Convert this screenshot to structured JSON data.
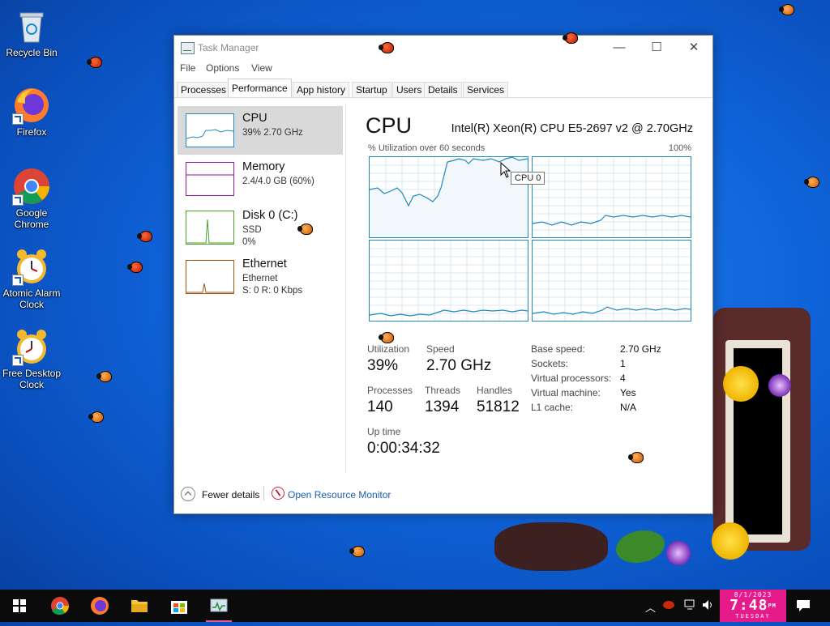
{
  "desktop": {
    "icons": [
      {
        "label": "Recycle Bin"
      },
      {
        "label": "Firefox"
      },
      {
        "label": "Google Chrome"
      },
      {
        "label": "Atomic Alarm Clock"
      },
      {
        "label": "Free Desktop Clock"
      }
    ]
  },
  "window": {
    "title": "Task Manager",
    "controls": {
      "minimize": "—",
      "maximize": "☐",
      "close": "✕"
    },
    "menu": [
      "File",
      "Options",
      "View"
    ],
    "tabs": [
      "Processes",
      "Performance",
      "App history",
      "Startup",
      "Users",
      "Details",
      "Services"
    ],
    "active_tab": "Performance"
  },
  "resources": [
    {
      "name": "CPU",
      "sub1": "39%  2.70 GHz",
      "sub2": "",
      "color": "#1f88b8"
    },
    {
      "name": "Memory",
      "sub1": "2.4/4.0 GB (60%)",
      "sub2": "",
      "color": "#8b1aa7"
    },
    {
      "name": "Disk 0 (C:)",
      "sub1": "SSD",
      "sub2": "0%",
      "color": "#4aa02c"
    },
    {
      "name": "Ethernet",
      "sub1": "Ethernet",
      "sub2": "S: 0  R: 0 Kbps",
      "color": "#a7560f"
    }
  ],
  "cpu": {
    "title": "CPU",
    "model": "Intel(R) Xeon(R) CPU E5-2697 v2 @ 2.70GHz",
    "util_label": "% Utilization over 60 seconds",
    "util_max": "100%",
    "tooltip": "CPU 0",
    "stats": {
      "utilization_label": "Utilization",
      "utilization": "39%",
      "speed_label": "Speed",
      "speed": "2.70 GHz",
      "processes_label": "Processes",
      "processes": "140",
      "threads_label": "Threads",
      "threads": "1394",
      "handles_label": "Handles",
      "handles": "51812",
      "uptime_label": "Up time",
      "uptime": "0:00:34:32"
    },
    "details": [
      {
        "label": "Base speed:",
        "value": "2.70 GHz"
      },
      {
        "label": "Sockets:",
        "value": "1"
      },
      {
        "label": "Virtual processors:",
        "value": "4"
      },
      {
        "label": "Virtual machine:",
        "value": "Yes"
      },
      {
        "label": "L1 cache:",
        "value": "N/A"
      }
    ]
  },
  "bottom": {
    "fewer_details": "Fewer details",
    "open_resource_monitor": "Open Resource Monitor"
  },
  "taskbar": {
    "clock_date": "8/1/2023",
    "clock_time": "7:48",
    "clock_ampm": "PM",
    "clock_day": "TUESDAY"
  }
}
